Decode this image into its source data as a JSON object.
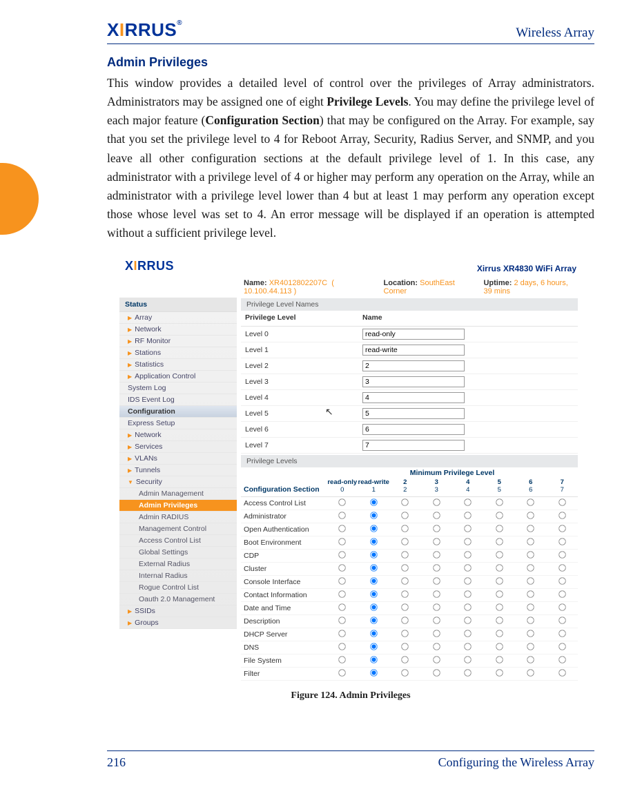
{
  "doc": {
    "header_title": "Wireless Array",
    "logo_text": "XIRRUS",
    "section_heading": "Admin Privileges",
    "paragraph_html": "This window provides a detailed level of control over the privileges of Array administrators. Administrators may be assigned one of eight <strong>Privilege Levels</strong>. You may define the privilege level of each major feature (<strong>Configuration Section</strong>) that may be configured on the Array. For example, say that you set the privilege level to 4 for Reboot Array, Security, Radius Server, and SNMP, and you leave all other configuration sections at the default privilege level of 1. In this case, any administrator with a privilege level of 4 or higher may perform any operation on the Array, while an administrator with a privilege level lower than 4 but at least 1 may perform any operation except those whose level was set to 4. An error message will be displayed if an operation is attempted without a sufficient privilege level.",
    "caption": "Figure 124. Admin Privileges",
    "footer_page": "216",
    "footer_section": "Configuring the Wireless Array"
  },
  "shot": {
    "logo": "XIRRUS",
    "model": "Xirrus XR4830 WiFi Array",
    "info": {
      "name_label": "Name:",
      "name_value": "XR4012802207C",
      "name_ip": "( 10.100.44.113 )",
      "location_label": "Location:",
      "location_value": "SouthEast Corner",
      "uptime_label": "Uptime:",
      "uptime_value": "2 days, 6 hours, 39 mins"
    },
    "nav": {
      "status_title": "Status",
      "status_items": [
        "Array",
        "Network",
        "RF Monitor",
        "Stations",
        "Statistics",
        "Application Control",
        "System Log",
        "IDS Event Log"
      ],
      "config_title": "Configuration",
      "config_items_top": [
        "Express Setup",
        "Network",
        "Services",
        "VLANs",
        "Tunnels",
        "Security"
      ],
      "security_children": [
        "Admin Management",
        "Admin Privileges",
        "Admin RADIUS",
        "Management Control",
        "Access Control List",
        "Global Settings",
        "External Radius",
        "Internal Radius",
        "Rogue Control List",
        "Oauth 2.0 Management"
      ],
      "config_items_bottom": [
        "SSIDs",
        "Groups"
      ]
    },
    "panel_names_title": "Privilege Level Names",
    "names_headers": {
      "level": "Privilege Level",
      "name": "Name"
    },
    "names_rows": [
      {
        "level": "Level 0",
        "value": "read-only"
      },
      {
        "level": "Level 1",
        "value": "read-write"
      },
      {
        "level": "Level 2",
        "value": "2"
      },
      {
        "level": "Level 3",
        "value": "3"
      },
      {
        "level": "Level 4",
        "value": "4"
      },
      {
        "level": "Level 5",
        "value": "5"
      },
      {
        "level": "Level 6",
        "value": "6"
      },
      {
        "level": "Level 7",
        "value": "7"
      }
    ],
    "panel_levels_title": "Privilege Levels",
    "minimum_title": "Minimum Privilege Level",
    "config_section_label": "Configuration Section",
    "columns": [
      {
        "top": "read-only",
        "bottom": "0"
      },
      {
        "top": "read-write",
        "bottom": "1"
      },
      {
        "top": "2",
        "bottom": "2"
      },
      {
        "top": "3",
        "bottom": "3"
      },
      {
        "top": "4",
        "bottom": "4"
      },
      {
        "top": "5",
        "bottom": "5"
      },
      {
        "top": "6",
        "bottom": "6"
      },
      {
        "top": "7",
        "bottom": "7"
      }
    ],
    "rows": [
      {
        "name": "Access Control List",
        "selected": 1
      },
      {
        "name": "Administrator",
        "selected": 1
      },
      {
        "name": "Open Authentication",
        "selected": 1
      },
      {
        "name": "Boot Environment",
        "selected": 1
      },
      {
        "name": "CDP",
        "selected": 1
      },
      {
        "name": "Cluster",
        "selected": 1
      },
      {
        "name": "Console Interface",
        "selected": 1
      },
      {
        "name": "Contact Information",
        "selected": 1
      },
      {
        "name": "Date and Time",
        "selected": 1
      },
      {
        "name": "Description",
        "selected": 1
      },
      {
        "name": "DHCP Server",
        "selected": 1
      },
      {
        "name": "DNS",
        "selected": 1
      },
      {
        "name": "File System",
        "selected": 1
      },
      {
        "name": "Filter",
        "selected": 1
      }
    ]
  }
}
